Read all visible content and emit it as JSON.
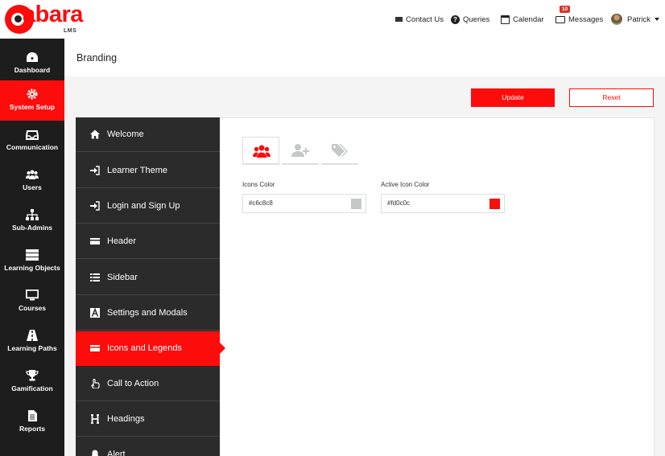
{
  "brand": {
    "name": "abara",
    "sub": "LMS"
  },
  "topnav": {
    "contact": "Contact Us",
    "queries": "Queries",
    "calendar": "Calendar",
    "messages": "Messages",
    "messages_badge": "10",
    "user": "Patrick"
  },
  "sidebar": {
    "items": [
      {
        "label": "Dashboard",
        "icon": "dashboard-icon"
      },
      {
        "label": "System Setup",
        "icon": "gear-icon"
      },
      {
        "label": "Communication",
        "icon": "inbox-icon"
      },
      {
        "label": "Users",
        "icon": "users-icon"
      },
      {
        "label": "Sub-Admins",
        "icon": "sitemap-icon"
      },
      {
        "label": "Learning Objects",
        "icon": "server-icon"
      },
      {
        "label": "Courses",
        "icon": "monitor-icon"
      },
      {
        "label": "Learning Paths",
        "icon": "road-icon"
      },
      {
        "label": "Gamification",
        "icon": "trophy-icon"
      },
      {
        "label": "Reports",
        "icon": "file-icon"
      }
    ]
  },
  "page": {
    "title": "Branding"
  },
  "actions": {
    "update": "Update",
    "reset": "Reset"
  },
  "submenu": {
    "items": [
      {
        "label": "Welcome",
        "icon": "home-icon"
      },
      {
        "label": "Learner Theme",
        "icon": "sign-in-icon"
      },
      {
        "label": "Login and Sign Up",
        "icon": "sign-in-icon"
      },
      {
        "label": "Header",
        "icon": "card-icon"
      },
      {
        "label": "Sidebar",
        "icon": "list-icon"
      },
      {
        "label": "Settings and Modals",
        "icon": "font-icon"
      },
      {
        "label": "Icons and Legends",
        "icon": "card-icon"
      },
      {
        "label": "Call to Action",
        "icon": "hand-pointer-icon"
      },
      {
        "label": "Headings",
        "icon": "header-icon"
      },
      {
        "label": "Alert",
        "icon": "bell-icon"
      }
    ]
  },
  "tabs": [
    {
      "icon": "users-icon",
      "active": true
    },
    {
      "icon": "user-plus-icon",
      "active": false
    },
    {
      "icon": "tags-icon",
      "active": false
    }
  ],
  "fields": {
    "icons_color": {
      "label": "Icons Color",
      "value": "#c6c8c8"
    },
    "active_icon_color": {
      "label": "Active Icon Color",
      "value": "#fd0c0c"
    }
  },
  "colors": {
    "accent": "#fd0c0c",
    "sidebar_bg": "#1d1d1d",
    "submenu_bg": "#2b2b2b",
    "icon_gray": "#c6c8c8"
  }
}
